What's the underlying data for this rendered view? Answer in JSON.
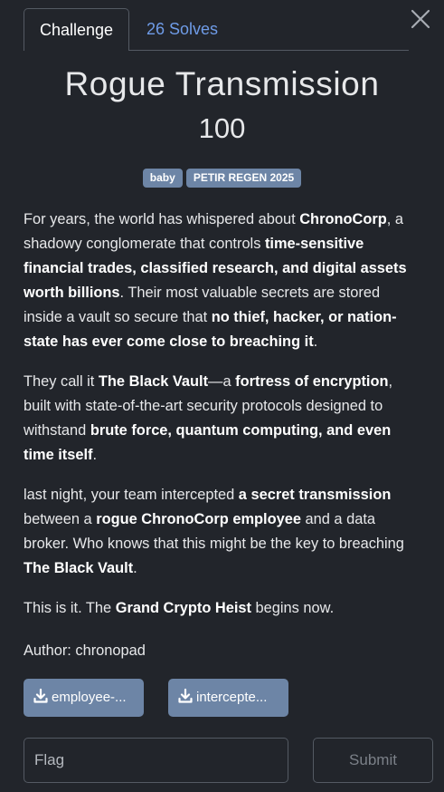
{
  "tabs": {
    "challenge": "Challenge",
    "solves": "26 Solves"
  },
  "challenge": {
    "title": "Rogue Transmission",
    "points": "100",
    "tags": [
      "baby",
      "PETIR REGEN 2025"
    ]
  },
  "description": {
    "p1": [
      {
        "t": "For years, the world has whispered about "
      },
      {
        "t": "ChronoCorp",
        "b": true
      },
      {
        "t": ", a shadowy conglomerate that controls "
      },
      {
        "t": "time-sensitive financial trades, classified research, and digital assets worth billions",
        "b": true
      },
      {
        "t": ". Their most valuable secrets are stored inside a vault so secure that "
      },
      {
        "t": "no thief, hacker, or nation-state has ever come close to breaching it",
        "b": true
      },
      {
        "t": "."
      }
    ],
    "p2": [
      {
        "t": "They call it "
      },
      {
        "t": "The Black Vault",
        "b": true
      },
      {
        "t": "—a "
      },
      {
        "t": "fortress of encryption",
        "b": true
      },
      {
        "t": ", built with state-of-the-art security protocols designed to withstand "
      },
      {
        "t": "brute force, quantum computing, and even time itself",
        "b": true
      },
      {
        "t": "."
      }
    ],
    "p3": [
      {
        "t": "last night, your team intercepted "
      },
      {
        "t": "a secret transmission",
        "b": true
      },
      {
        "t": " between a "
      },
      {
        "t": "rogue ChronoCorp employee",
        "b": true
      },
      {
        "t": " and a data broker. Who knows that this might be the key to breaching "
      },
      {
        "t": "The Black Vault",
        "b": true
      },
      {
        "t": "."
      }
    ],
    "p4": [
      {
        "t": "This is it. The "
      },
      {
        "t": "Grand Crypto Heist",
        "b": true
      },
      {
        "t": " begins now."
      }
    ]
  },
  "author": "Author: chronopad",
  "files": [
    {
      "label": "employee-...",
      "icon": "download-icon"
    },
    {
      "label": "intercepte...",
      "icon": "download-icon"
    }
  ],
  "flag_input": {
    "placeholder": "Flag",
    "value": ""
  },
  "submit_label": "Submit",
  "close_icon": "close-icon",
  "colors": {
    "background": "#22252b",
    "accent_link": "#6f9ce8",
    "tag_bg": "#6d85a6",
    "border": "#545a63"
  }
}
